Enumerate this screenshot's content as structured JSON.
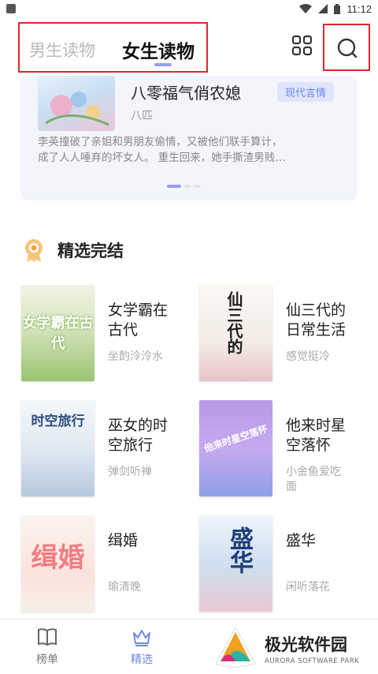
{
  "status_bar": {
    "time": "11:12"
  },
  "header": {
    "tabs": [
      {
        "label": "男生读物"
      },
      {
        "label": "女生读物"
      }
    ]
  },
  "banner": {
    "title": "八零福气俏农媳",
    "tag": "现代言情",
    "author": "八匹",
    "description_line1": "李英撞破了亲姐和男朋友偷情，又被他们联手算计，",
    "description_line2": "成了人人唾弃的坏女人。 重生回来，她手撕渣男贱…"
  },
  "section": {
    "title": "精选完结"
  },
  "books": [
    {
      "title_line1": "女学霸在",
      "title_line2": "古代",
      "author": "坐酌泠泠水",
      "cover_text": "女学霸在古代"
    },
    {
      "title_line1": "仙三代的",
      "title_line2": "日常生活",
      "author": "感觉挺冷",
      "cover_text": "仙三代的"
    },
    {
      "title_line1": "巫女的时",
      "title_line2": "空旅行",
      "author": "弹剑听禅",
      "cover_text": "时空旅行"
    },
    {
      "title_line1": "他来时星",
      "title_line2": "空落怀",
      "author_line1": "小金鱼爱吃",
      "author_line2": "面",
      "cover_text": "他来时星空落怀"
    },
    {
      "title_line1": "缉婚",
      "title_line2": "",
      "author": "瑜清晚",
      "cover_text": "缉婚"
    },
    {
      "title_line1": "盛华",
      "title_line2": "",
      "author": "闲听落花",
      "cover_text": "盛华"
    }
  ],
  "bottom_nav": {
    "items": [
      {
        "label": "榜单"
      },
      {
        "label": "精选"
      }
    ]
  },
  "watermark": {
    "name": "极光软件园",
    "sub": "AURORA SOFTWARE PARK"
  },
  "colors": {
    "accent": "#6e87e6",
    "highlight_box": "#e0262b",
    "muted": "#aaaaaa"
  },
  "icons": [
    "grid-icon",
    "search-icon",
    "medal-icon",
    "book-icon",
    "crown-icon",
    "wifi-icon",
    "signal-icon",
    "battery-icon"
  ]
}
